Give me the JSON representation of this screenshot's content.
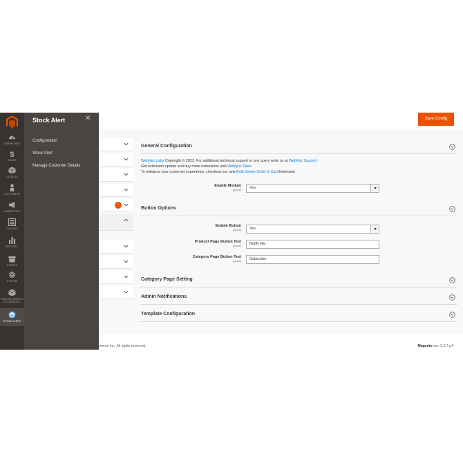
{
  "nav": {
    "items": [
      {
        "label": "Dashboard",
        "icon": "dashboard-icon"
      },
      {
        "label": "Sales",
        "icon": "dollar-icon"
      },
      {
        "label": "Catalog",
        "icon": "box-icon"
      },
      {
        "label": "Customers",
        "icon": "person-icon"
      },
      {
        "label": "Marketing",
        "icon": "megaphone-icon"
      },
      {
        "label": "Content",
        "icon": "layout-icon"
      },
      {
        "label": "Reports",
        "icon": "bar-chart-icon"
      },
      {
        "label": "Stores",
        "icon": "storefront-icon"
      },
      {
        "label": "System",
        "icon": "gear-icon"
      },
      {
        "label": "Find Partners & Extensions",
        "icon": "cube-icon"
      },
      {
        "label": "Stock Alert",
        "icon": "weblytic-icon"
      }
    ]
  },
  "flyout": {
    "title": "Stock Alert",
    "close": "✕",
    "links": [
      "Configuration",
      "Stock Alert",
      "Manage Customer Details"
    ]
  },
  "header": {
    "save_label": "Save Config"
  },
  "tabs": {
    "badge": "!"
  },
  "general": {
    "title": "General Configuration",
    "line1_link": "Weblytic Labs",
    "line1_text": " Copyright © 2023. For additional technical support or any query write us at ",
    "line1_link2": "Weblytic Support",
    "line2_text": "Get extension update and buy more extensions visit ",
    "line2_link": "Weblytic Store",
    "line3_text": "To enhance your customer experience, checkout our new ",
    "line3_link": "Bulk Delete Order & Cart",
    "line3_tail": " Extension",
    "enable_module_label": "Enable Module",
    "enable_module_scope": "[global]",
    "enable_module_value": "Yes"
  },
  "button_options": {
    "title": "Button Options",
    "enable_button_label": "Enable Button",
    "enable_button_scope": "[global]",
    "enable_button_value": "Yes",
    "product_text_label": "Product Page Button Text",
    "product_text_scope": "[global]",
    "product_text_value": "Notify Me",
    "category_text_label": "Category Page Button Text",
    "category_text_scope": "[global]",
    "category_text_value": "Subscribe"
  },
  "sections": {
    "category_page": "Category Page Setting",
    "admin_notifications": "Admin Notifications",
    "template": "Template Configuration"
  },
  "footer": {
    "copyright": "merce Inc. All rights reserved.",
    "version_brand": "Magento",
    "version_text": " ver. 2.3.7-p4"
  },
  "colors": {
    "accent": "#eb5202",
    "link": "#007bdb",
    "nav_bg": "#373330",
    "flyout_bg": "#4a4542"
  }
}
